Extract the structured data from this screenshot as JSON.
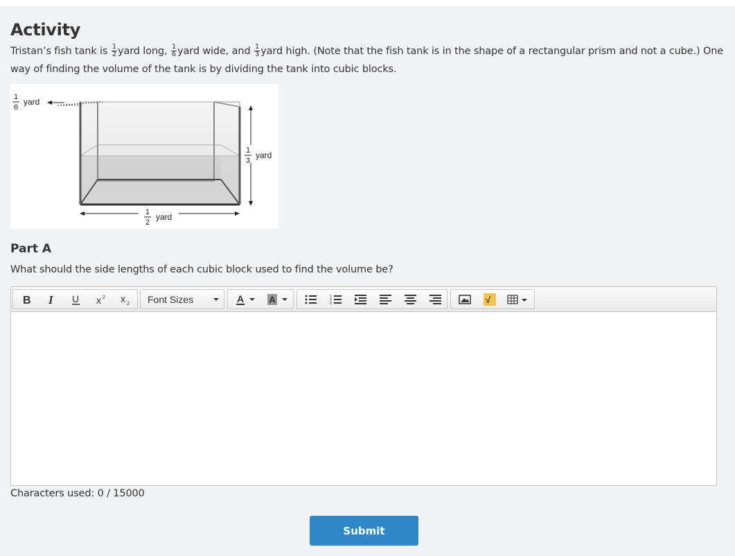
{
  "activity": {
    "title": "Activity",
    "prompt_1": "Tristan’s fish tank is ",
    "frac_length": {
      "num": "1",
      "den": "2"
    },
    "prompt_2": "yard long, ",
    "frac_width": {
      "num": "1",
      "den": "6"
    },
    "prompt_3": "yard wide, and ",
    "frac_height": {
      "num": "1",
      "den": "3"
    },
    "prompt_4": "yard high. (Note that the fish tank is in the shape of a rectangular prism and not a cube.) One way of finding the volume of the tank is by dividing the tank into cubic blocks."
  },
  "figure": {
    "width_label": {
      "num": "1",
      "den": "6",
      "unit": "yard"
    },
    "height_label": {
      "num": "1",
      "den": "3",
      "unit": "yard"
    },
    "length_label": {
      "num": "1",
      "den": "2",
      "unit": "yard"
    }
  },
  "part": {
    "title": "Part A",
    "question": "What should the side lengths of each cubic block used to find the volume be?"
  },
  "editor": {
    "font_sizes_label": "Font Sizes",
    "toolbar_icons": [
      "bold-icon",
      "italic-icon",
      "underline-icon",
      "superscript-icon",
      "subscript-icon",
      "font-color-icon",
      "background-color-icon",
      "bullet-list-icon",
      "numbered-list-icon",
      "indent-icon",
      "align-left-icon",
      "align-center-icon",
      "align-right-icon",
      "image-icon",
      "equation-icon",
      "table-icon"
    ],
    "text": "",
    "counter": "Characters used: 0 / 15000"
  },
  "submit_label": "Submit",
  "colors": {
    "background": "#f1f2f3",
    "accent": "#2e88c6",
    "text": "#333333"
  }
}
